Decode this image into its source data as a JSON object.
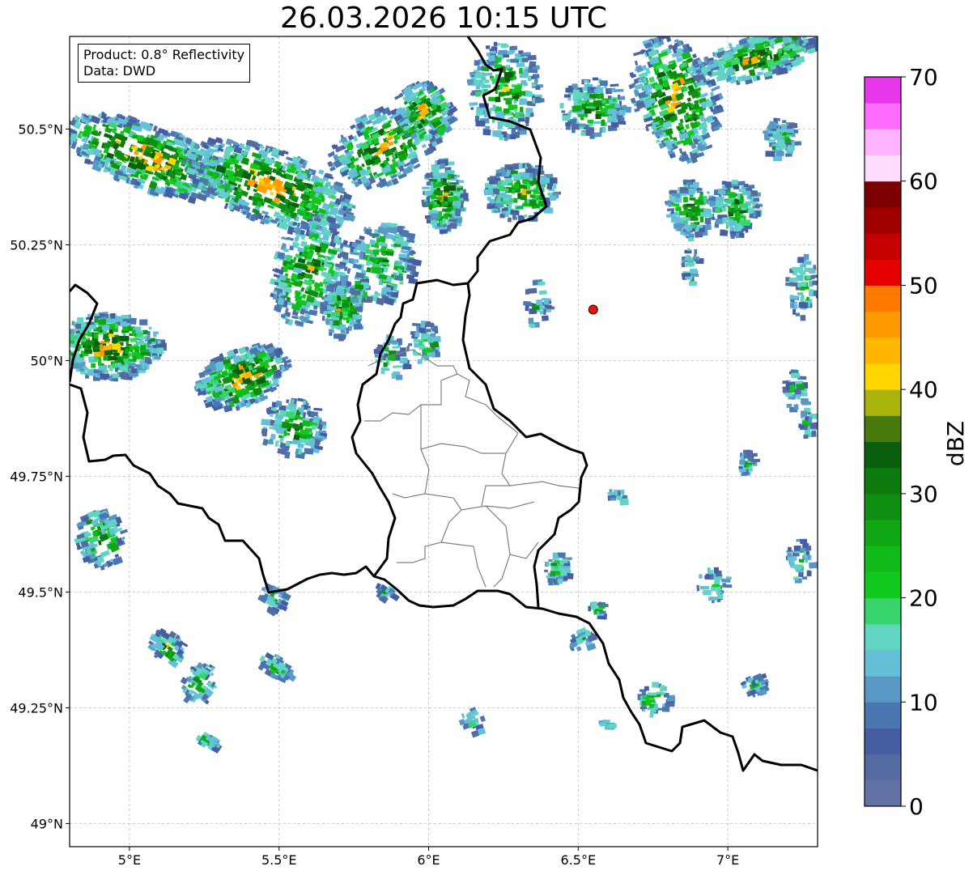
{
  "title": "26.03.2026 10:15 UTC",
  "info_box": {
    "product": "Product: 0.8° Reflectivity",
    "data": "Data: DWD"
  },
  "axes": {
    "lon_ticks": [
      "5°E",
      "5.5°E",
      "6°E",
      "6.5°E",
      "7°E"
    ],
    "lat_ticks": [
      "50.5°N",
      "50.25°N",
      "50°N",
      "49.75°N",
      "49.5°N",
      "49.25°N",
      "49°N"
    ],
    "lon_range": [
      4.8,
      7.3
    ],
    "lat_range": [
      48.95,
      50.7
    ],
    "grid": true
  },
  "colorbar": {
    "label": "dBZ",
    "ticks": [
      "0",
      "10",
      "20",
      "30",
      "40",
      "50",
      "60",
      "70"
    ],
    "range": [
      0,
      70
    ],
    "colors": [
      "#6271a6",
      "#536ba0",
      "#445da3",
      "#4a76b2",
      "#5998c4",
      "#64bfd8",
      "#61d5c3",
      "#3ad46e",
      "#11c91d",
      "#10bb1b",
      "#0fa814",
      "#0f8f12",
      "#0c7a0f",
      "#0a5e0c",
      "#487a0c",
      "#aab30a",
      "#ffd600",
      "#ffb700",
      "#ff9a00",
      "#ff7a00",
      "#e60000",
      "#c40000",
      "#a00000",
      "#7c0000",
      "#ffddff",
      "#ffb3ff",
      "#ff6cff",
      "#e637ea"
    ]
  },
  "marker": {
    "lon": 6.55,
    "lat": 50.11,
    "color": "#ee1111"
  }
}
